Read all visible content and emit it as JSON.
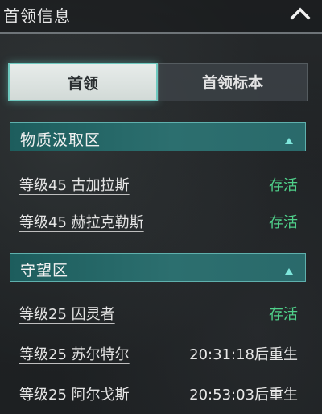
{
  "header": {
    "title": "首领信息",
    "collapse_icon": "chevron-up-icon"
  },
  "tabs": [
    {
      "label": "首领",
      "active": true
    },
    {
      "label": "首领标本",
      "active": false
    }
  ],
  "sections": [
    {
      "title": "物质汲取区",
      "arrow_icon": "triangle-up-icon",
      "bosses": [
        {
          "name": "等级45 古加拉斯",
          "status": "存活",
          "state": "alive"
        },
        {
          "name": "等级45 赫拉克勒斯",
          "status": "存活",
          "state": "alive"
        }
      ]
    },
    {
      "title": "守望区",
      "arrow_icon": "triangle-up-icon",
      "bosses": [
        {
          "name": "等级25 囚灵者",
          "status": "存活",
          "state": "alive"
        },
        {
          "name": "等级25 苏尔特尔",
          "status": "20:31:18后重生",
          "state": "respawning"
        },
        {
          "name": "等级25 阿尔戈斯",
          "status": "20:53:03后重生",
          "state": "respawning"
        }
      ]
    }
  ],
  "colors": {
    "accent": "#2c6f6f",
    "alive": "#4fd08a",
    "tab_glow": "#6fc9c0"
  }
}
